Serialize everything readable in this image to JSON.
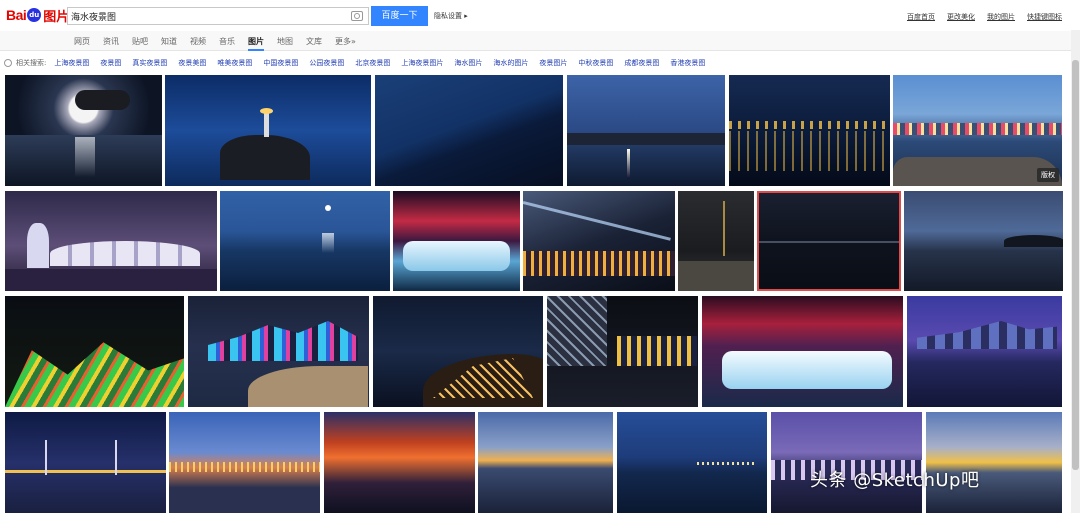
{
  "brand": {
    "logo_left": "Bai",
    "logo_mid": "du",
    "logo_right": "图片"
  },
  "search": {
    "query": "海水夜景图",
    "button_label": "百度一下",
    "private_link": "隐私设置"
  },
  "top_links": [
    "百度首页",
    "更改美化",
    "我的图片",
    "快捷键图标"
  ],
  "nav": {
    "tabs": [
      "网页",
      "资讯",
      "贴吧",
      "知道",
      "视频",
      "音乐",
      "图片",
      "地图",
      "文库",
      "更多»"
    ],
    "active_index": 6
  },
  "related": {
    "label": "相关搜索:",
    "items": [
      "上海夜景图",
      "夜景图",
      "真实夜景图",
      "夜景美图",
      "唯美夜景图",
      "中国夜景图",
      "公园夜景图",
      "北京夜景图",
      "上海夜景图片",
      "海水图片",
      "海水的图片",
      "夜景图片",
      "中秋夜景图",
      "成都夜景图",
      "香港夜景图"
    ]
  },
  "images": [
    {
      "scene": "moon-clouds-sea"
    },
    {
      "scene": "lighthouse-bay"
    },
    {
      "scene": "blue-waves"
    },
    {
      "scene": "dusk-coast-light"
    },
    {
      "scene": "city-lights-harbor"
    },
    {
      "scene": "skyline-bay-sunset"
    },
    {
      "scene": "illuminated-pavilions"
    },
    {
      "scene": "moonlit-bay"
    },
    {
      "scene": "niagara-falls-red"
    },
    {
      "scene": "city-searchlights"
    },
    {
      "scene": "pier-crane-night"
    },
    {
      "scene": "dark-horizon"
    },
    {
      "scene": "twilight-lake"
    },
    {
      "scene": "neon-park"
    },
    {
      "scene": "city-skyline-shore"
    },
    {
      "scene": "hill-castle-lights"
    },
    {
      "scene": "glass-building-night"
    },
    {
      "scene": "niagara-falls-purple"
    },
    {
      "scene": "city-reflection-purple"
    },
    {
      "scene": "suspension-bridge"
    },
    {
      "scene": "orange-sunset-city"
    },
    {
      "scene": "fiery-sky-clouds"
    },
    {
      "scene": "golden-horizon"
    },
    {
      "scene": "blue-twilight-pier"
    },
    {
      "scene": "city-dusk-purple"
    },
    {
      "scene": "yellow-sunset-sea"
    }
  ],
  "badge_label": "版权",
  "watermark": "头条 @SketchUp吧",
  "colors": {
    "accent": "#3385ff",
    "brand_red": "#e10601",
    "link": "#2440b3"
  }
}
